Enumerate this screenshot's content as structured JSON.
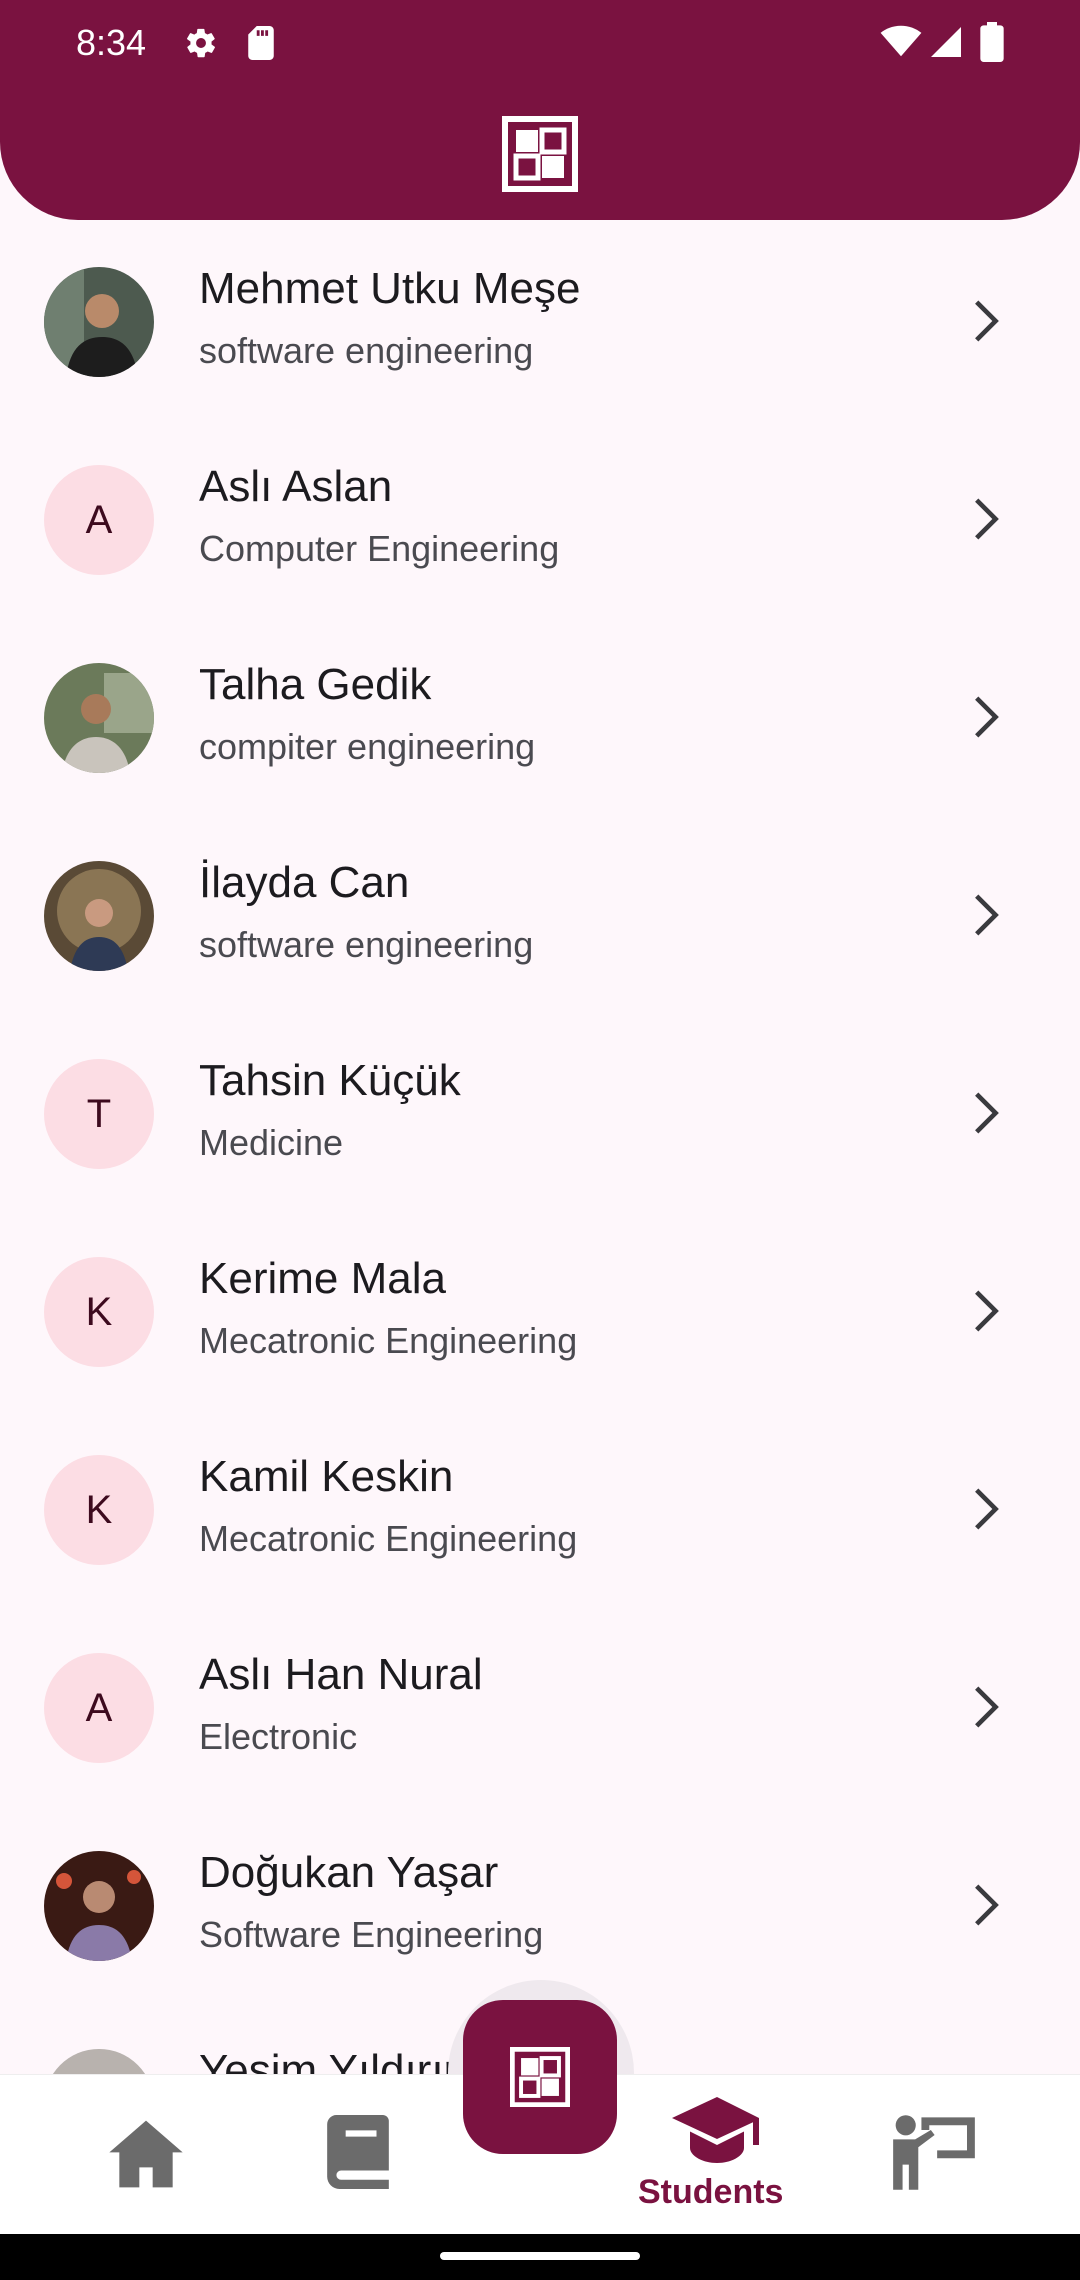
{
  "status_bar": {
    "time": "8:34"
  },
  "students": [
    {
      "name": "Mehmet Utku Meşe",
      "department": "software engineering",
      "avatar_type": "photo",
      "initial": ""
    },
    {
      "name": "Aslı Aslan",
      "department": "Computer Engineering",
      "avatar_type": "letter",
      "initial": "A"
    },
    {
      "name": "Talha Gedik",
      "department": "compiter engineering",
      "avatar_type": "photo",
      "initial": ""
    },
    {
      "name": "İlayda Can",
      "department": "software engineering",
      "avatar_type": "photo",
      "initial": ""
    },
    {
      "name": "Tahsin Küçük",
      "department": "Medicine",
      "avatar_type": "letter",
      "initial": "T"
    },
    {
      "name": "Kerime Mala",
      "department": "Mecatronic Engineering",
      "avatar_type": "letter",
      "initial": "K"
    },
    {
      "name": "Kamil Keskin",
      "department": "Mecatronic Engineering",
      "avatar_type": "letter",
      "initial": "K"
    },
    {
      "name": "Aslı Han Nural",
      "department": "Electronic",
      "avatar_type": "letter",
      "initial": "A"
    },
    {
      "name": "Doğukan Yaşar",
      "department": "Software Engineering",
      "avatar_type": "photo",
      "initial": ""
    },
    {
      "name": "Yeşim Yıldırım",
      "department": "",
      "avatar_type": "photo",
      "initial": ""
    }
  ],
  "bottom_nav": {
    "items": [
      {
        "icon": "home-icon",
        "label": ""
      },
      {
        "icon": "book-icon",
        "label": ""
      },
      {
        "icon": "graduation-cap-icon",
        "label": "Students",
        "active": true
      },
      {
        "icon": "teacher-icon",
        "label": ""
      }
    ]
  },
  "fab": {
    "icon": "app-logo-icon"
  },
  "colors": {
    "primary": "#7a1240",
    "background": "#fef7fb",
    "avatar_letter_bg": "#fcdde4",
    "inactive_icon": "#6b6b6b"
  }
}
